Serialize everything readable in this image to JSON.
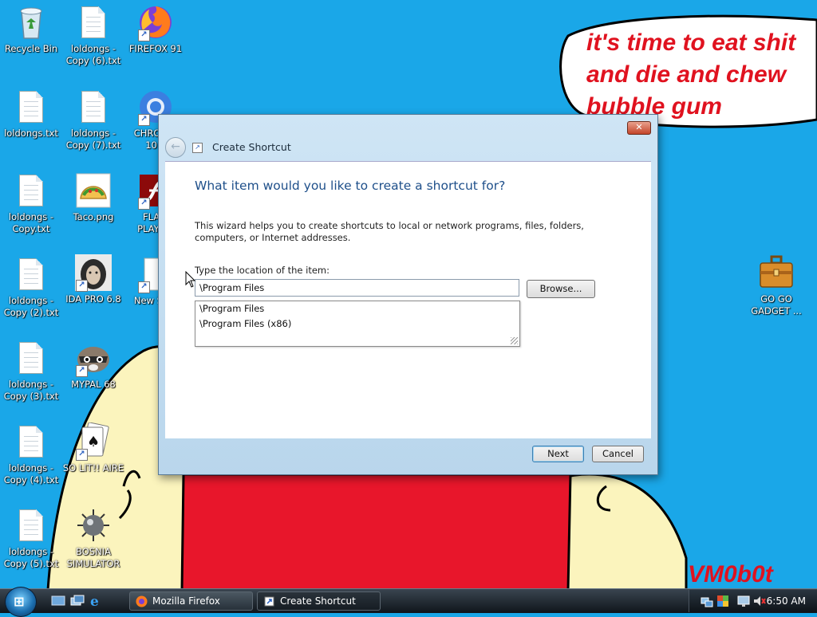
{
  "desktop": {
    "icons": [
      {
        "label": "Recycle Bin",
        "icon": "recycle-bin-icon"
      },
      {
        "label": "loldongs - Copy (6).txt",
        "icon": "text-file-icon"
      },
      {
        "label": "FIREFOX 91",
        "icon": "firefox-icon"
      },
      {
        "label": "loldongs.txt",
        "icon": "text-file-icon"
      },
      {
        "label": "loldongs - Copy (7).txt",
        "icon": "text-file-icon"
      },
      {
        "label": "CHROM... 10...",
        "icon": "chrome-icon"
      },
      {
        "label": "loldongs - Copy.txt",
        "icon": "text-file-icon"
      },
      {
        "label": "Taco.png",
        "icon": "taco-image-icon"
      },
      {
        "label": "FLA... PLAYE...",
        "icon": "flash-player-icon"
      },
      {
        "label": "loldongs - Copy (2).txt",
        "icon": "text-file-icon"
      },
      {
        "label": "IDA PRO 6.8",
        "icon": "ida-pro-icon"
      },
      {
        "label": "New Sh...",
        "icon": "new-shortcut-icon"
      },
      {
        "label": "loldongs - Copy (3).txt",
        "icon": "text-file-icon"
      },
      {
        "label": "MYPAL 68",
        "icon": "mypal-raccoon-icon"
      },
      {
        "label": "loldongs - Copy (4).txt",
        "icon": "text-file-icon"
      },
      {
        "label": "SO LIT!! AIRE",
        "icon": "solitaire-icon"
      },
      {
        "label": "loldongs - Copy (5).txt",
        "icon": "text-file-icon"
      },
      {
        "label": "BOSNIA SIMULATOR",
        "icon": "minesweeper-icon"
      },
      {
        "label": "GO GO GADGET ...",
        "icon": "briefcase-icon"
      }
    ],
    "wallpaper": {
      "speech_bubble_lines": [
        "it's time to eat shit",
        "and die and chew",
        "bubble gum"
      ],
      "signature": "VM0b0t",
      "colors": {
        "sky": "#1aa7e8",
        "shirt": "#e8162b",
        "skin": "#fbf4bd",
        "text": "#e0121f"
      }
    }
  },
  "dialog": {
    "title": "Create Shortcut",
    "heading": "What item would you like to create a shortcut for?",
    "description": "This wizard helps you to create shortcuts to local or network programs, files, folders, computers, or Internet addresses.",
    "location_label": "Type the location of the item:",
    "location_value": "\\Program Files",
    "browse_label": "Browse...",
    "suggestions": [
      "\\Program Files",
      "\\Program Files (x86)"
    ],
    "next_label": "Next",
    "cancel_label": "Cancel",
    "close_symbol": "✕",
    "back_symbol": "←"
  },
  "taskbar": {
    "tasks": [
      {
        "label": "Mozilla Firefox",
        "icon": "firefox-icon"
      },
      {
        "label": "Create Shortcut",
        "icon": "shortcut-icon"
      }
    ],
    "clock": "6:50 AM"
  }
}
